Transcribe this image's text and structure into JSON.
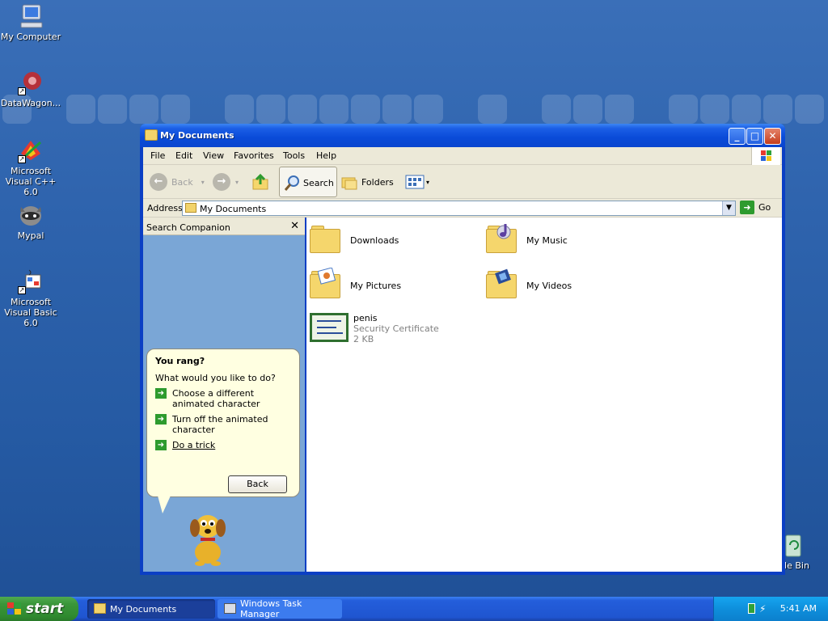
{
  "desktop": {
    "icons": [
      {
        "label": "My Computer"
      },
      {
        "label": "DataWagon..."
      },
      {
        "label": "Microsoft Visual C++ 6.0"
      },
      {
        "label": "Mypal"
      },
      {
        "label": "Microsoft Visual Basic 6.0"
      }
    ],
    "recycle_label": "cle Bin"
  },
  "window": {
    "title": "My Documents",
    "menu": [
      "File",
      "Edit",
      "View",
      "Favorites",
      "Tools",
      "Help"
    ],
    "toolbar": {
      "back": "Back",
      "search": "Search",
      "folders": "Folders"
    },
    "address": {
      "label": "Address",
      "value": "My Documents",
      "go": "Go"
    }
  },
  "search_companion": {
    "title": "Search Companion",
    "balloon": {
      "heading": "You rang?",
      "question": "What would you like to do?",
      "options": [
        {
          "label": "Choose a different animated character"
        },
        {
          "label": "Turn off the animated character"
        },
        {
          "label": "Do a trick"
        }
      ],
      "back": "Back"
    }
  },
  "files": [
    {
      "name": "Downloads",
      "type": "folder"
    },
    {
      "name": "My Music",
      "type": "folder"
    },
    {
      "name": "My Pictures",
      "type": "folder"
    },
    {
      "name": "My Videos",
      "type": "folder"
    },
    {
      "name": "penis",
      "subtitle": "Security Certificate",
      "size": "2 KB",
      "type": "certificate"
    }
  ],
  "taskbar": {
    "start": "start",
    "tasks": [
      {
        "label": "My Documents"
      },
      {
        "label": "Windows Task Manager"
      }
    ],
    "clock": "5:41 AM"
  },
  "colors": {
    "titlebar": "#0a4bd8",
    "start_green": "#3a963a",
    "tray_blue": "#0e8fdc"
  }
}
